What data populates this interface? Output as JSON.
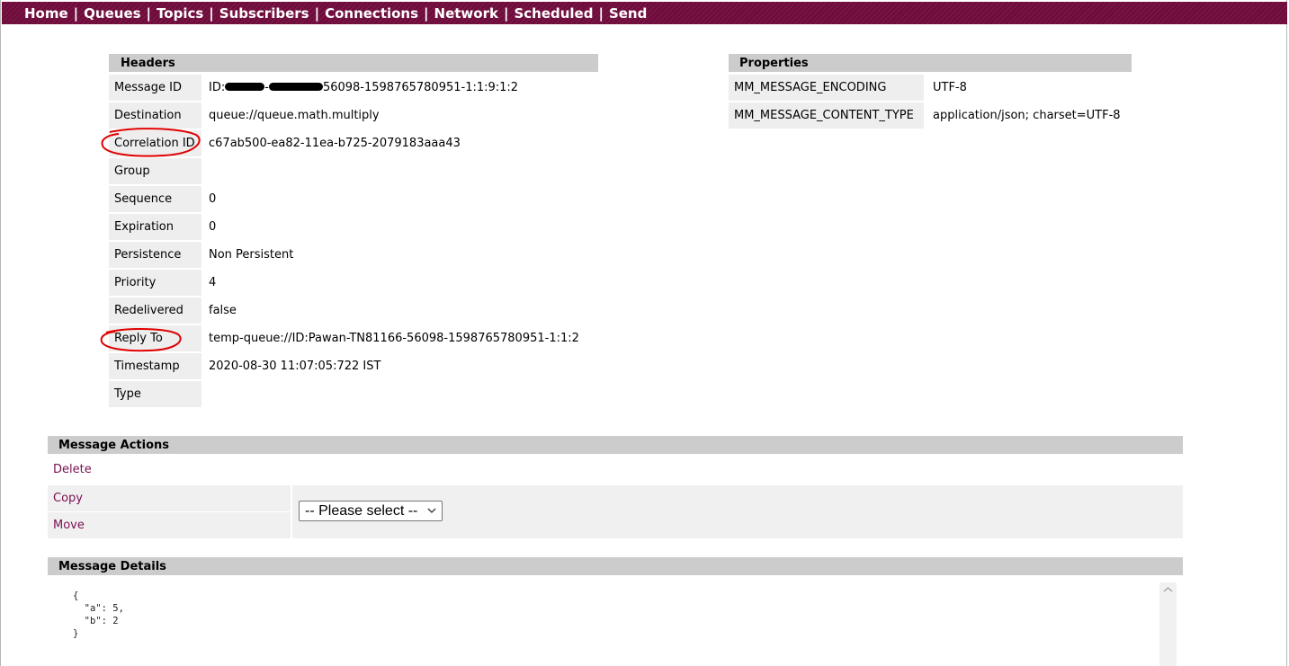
{
  "nav": {
    "items": [
      "Home",
      "Queues",
      "Topics",
      "Subscribers",
      "Connections",
      "Network",
      "Scheduled",
      "Send"
    ],
    "separator": "|"
  },
  "headers": {
    "title": "Headers",
    "rows": [
      {
        "label": "Message ID",
        "prefix": "ID:",
        "mid": "-",
        "suffix": "56098-1598765780951-1:1:9:1:2"
      },
      {
        "label": "Destination",
        "value": "queue://queue.math.multiply"
      },
      {
        "label": "Correlation ID",
        "value": "c67ab500-ea82-11ea-b725-2079183aaa43"
      },
      {
        "label": "Group",
        "value": ""
      },
      {
        "label": "Sequence",
        "value": "0"
      },
      {
        "label": "Expiration",
        "value": "0"
      },
      {
        "label": "Persistence",
        "value": "Non Persistent"
      },
      {
        "label": "Priority",
        "value": "4"
      },
      {
        "label": "Redelivered",
        "value": "false"
      },
      {
        "label": "Reply To",
        "value": "temp-queue://ID:Pawan-TN81166-56098-1598765780951-1:1:2"
      },
      {
        "label": "Timestamp",
        "value": "2020-08-30 11:07:05:722 IST"
      },
      {
        "label": "Type",
        "value": ""
      }
    ]
  },
  "properties": {
    "title": "Properties",
    "rows": [
      {
        "name": "MM_MESSAGE_ENCODING",
        "value": "UTF-8"
      },
      {
        "name": "MM_MESSAGE_CONTENT_TYPE",
        "value": "application/json; charset=UTF-8"
      }
    ]
  },
  "actions": {
    "title": "Message Actions",
    "delete": "Delete",
    "copy": "Copy",
    "move": "Move",
    "select_value": "-- Please select --"
  },
  "details": {
    "title": "Message Details",
    "body": "{\n  \"a\": 5,\n  \"b\": 2\n}"
  },
  "colors": {
    "nav_bg": "#6f0c3c",
    "link": "#7a1050",
    "section_header": "#cccccc",
    "label_bg": "#eeeeee",
    "annotation": "#e00000"
  },
  "icons": {
    "select_arrow": "chevron-down-icon",
    "scroll_up": "scroll-up-arrow-icon"
  }
}
